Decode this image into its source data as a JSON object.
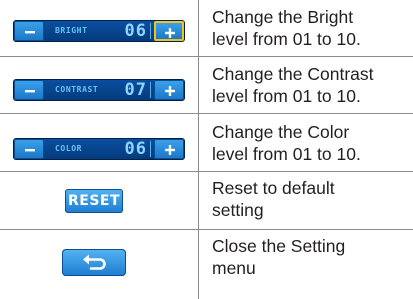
{
  "rows": [
    {
      "control": {
        "label": "BRIGHT",
        "value": "06",
        "minus_symbol": "−",
        "plus_symbol": "+",
        "active_button": "plus"
      },
      "description": "Change the Bright\nlevel from 01 to 10."
    },
    {
      "control": {
        "label": "CONTRAST",
        "value": "07",
        "minus_symbol": "−",
        "plus_symbol": "+"
      },
      "description": "Change the Contrast\nlevel from 01 to 10."
    },
    {
      "control": {
        "label": "COLOR",
        "value": "06",
        "minus_symbol": "−",
        "plus_symbol": "+"
      },
      "description": "Change the Color\nlevel from 01 to 10."
    },
    {
      "control": {
        "label": "RESET"
      },
      "description": "Reset to default\nsetting"
    },
    {
      "control": {
        "icon": "back-arrow-icon"
      },
      "description": "Close the Setting\nmenu"
    }
  ],
  "colors": {
    "bar_background": "#0a4fa0",
    "button_blue": "#1c78c8",
    "active_outline": "#f2c318",
    "label_text": "#66c2f5",
    "value_text": "#8fd4ff",
    "description_text": "#231f20",
    "rule": "#8c8c8c"
  }
}
